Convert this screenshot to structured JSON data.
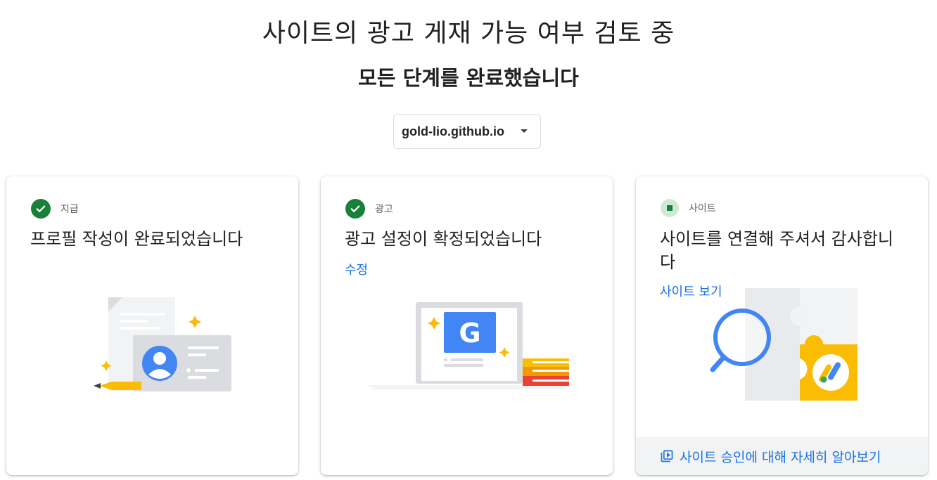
{
  "header": {
    "title": "사이트의 광고 게재 가능 여부 검토 중",
    "subtitle": "모든 단계를 완료했습니다"
  },
  "site_selector": {
    "value": "gold-lio.github.io",
    "icon": "dropdown-caret-icon"
  },
  "cards": [
    {
      "status": "complete",
      "status_label": "지급",
      "title": "프로필 작성이 완료되었습니다",
      "illustration": "profile-card-illustration"
    },
    {
      "status": "complete",
      "status_label": "광고",
      "title": "광고 설정이 확정되었습니다",
      "link_label": "수정",
      "illustration": "laptop-google-illustration"
    },
    {
      "status": "pending",
      "status_label": "사이트",
      "title": "사이트를 연결해 주셔서 감사합니다",
      "link_label": "사이트 보기",
      "illustration": "puzzle-magnifier-illustration",
      "footer_label": "사이트 승인에 대해 자세히 알아보기",
      "footer_icon": "video-library-icon"
    }
  ],
  "colors": {
    "success": "#188038",
    "link": "#1a73e8",
    "google_blue": "#4285f4",
    "google_yellow": "#fbbc04",
    "google_red": "#ea4335",
    "google_green": "#34a853"
  }
}
